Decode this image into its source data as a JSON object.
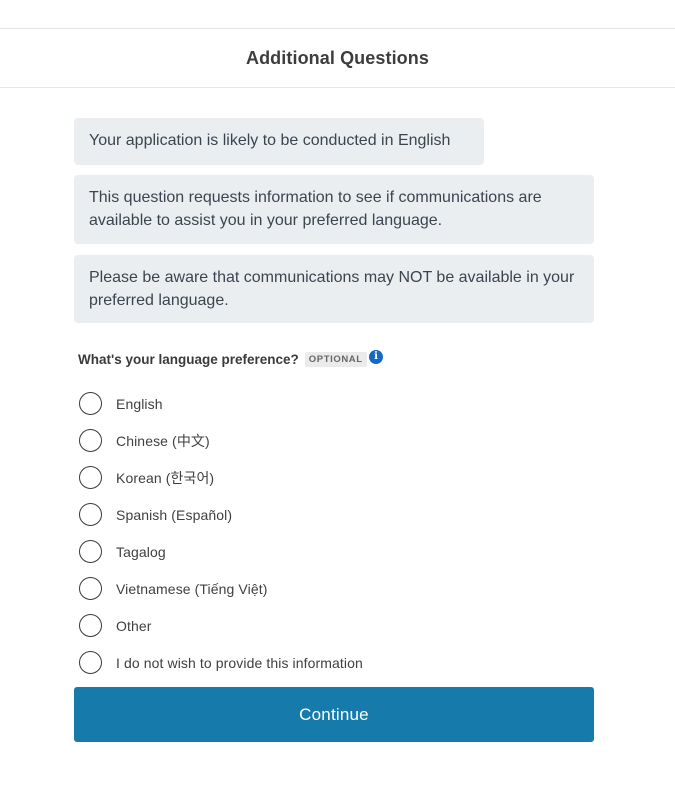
{
  "header": {
    "title": "Additional Questions"
  },
  "notices": [
    "Your application is likely to be conducted in English",
    "This question requests information to see if communications are available to assist you in your preferred language.",
    "Please be aware that communications may NOT be available in your preferred language."
  ],
  "question": {
    "label": "What's your language preference?",
    "badge": "OPTIONAL",
    "info_icon": "info-icon",
    "info_symbol": "i"
  },
  "options": [
    {
      "label": "English",
      "selected": false
    },
    {
      "label": "Chinese (中文)",
      "selected": false
    },
    {
      "label": "Korean (한국어)",
      "selected": false
    },
    {
      "label": "Spanish (Español)",
      "selected": false
    },
    {
      "label": "Tagalog",
      "selected": false
    },
    {
      "label": "Vietnamese (Tiếng Việt)",
      "selected": false
    },
    {
      "label": "Other",
      "selected": false
    },
    {
      "label": "I do not wish to provide this information",
      "selected": false
    }
  ],
  "continue_button": {
    "label": "Continue"
  },
  "colors": {
    "accent": "#167aab",
    "notice_bg": "#ebeef1",
    "info_icon": "#1768c4"
  }
}
